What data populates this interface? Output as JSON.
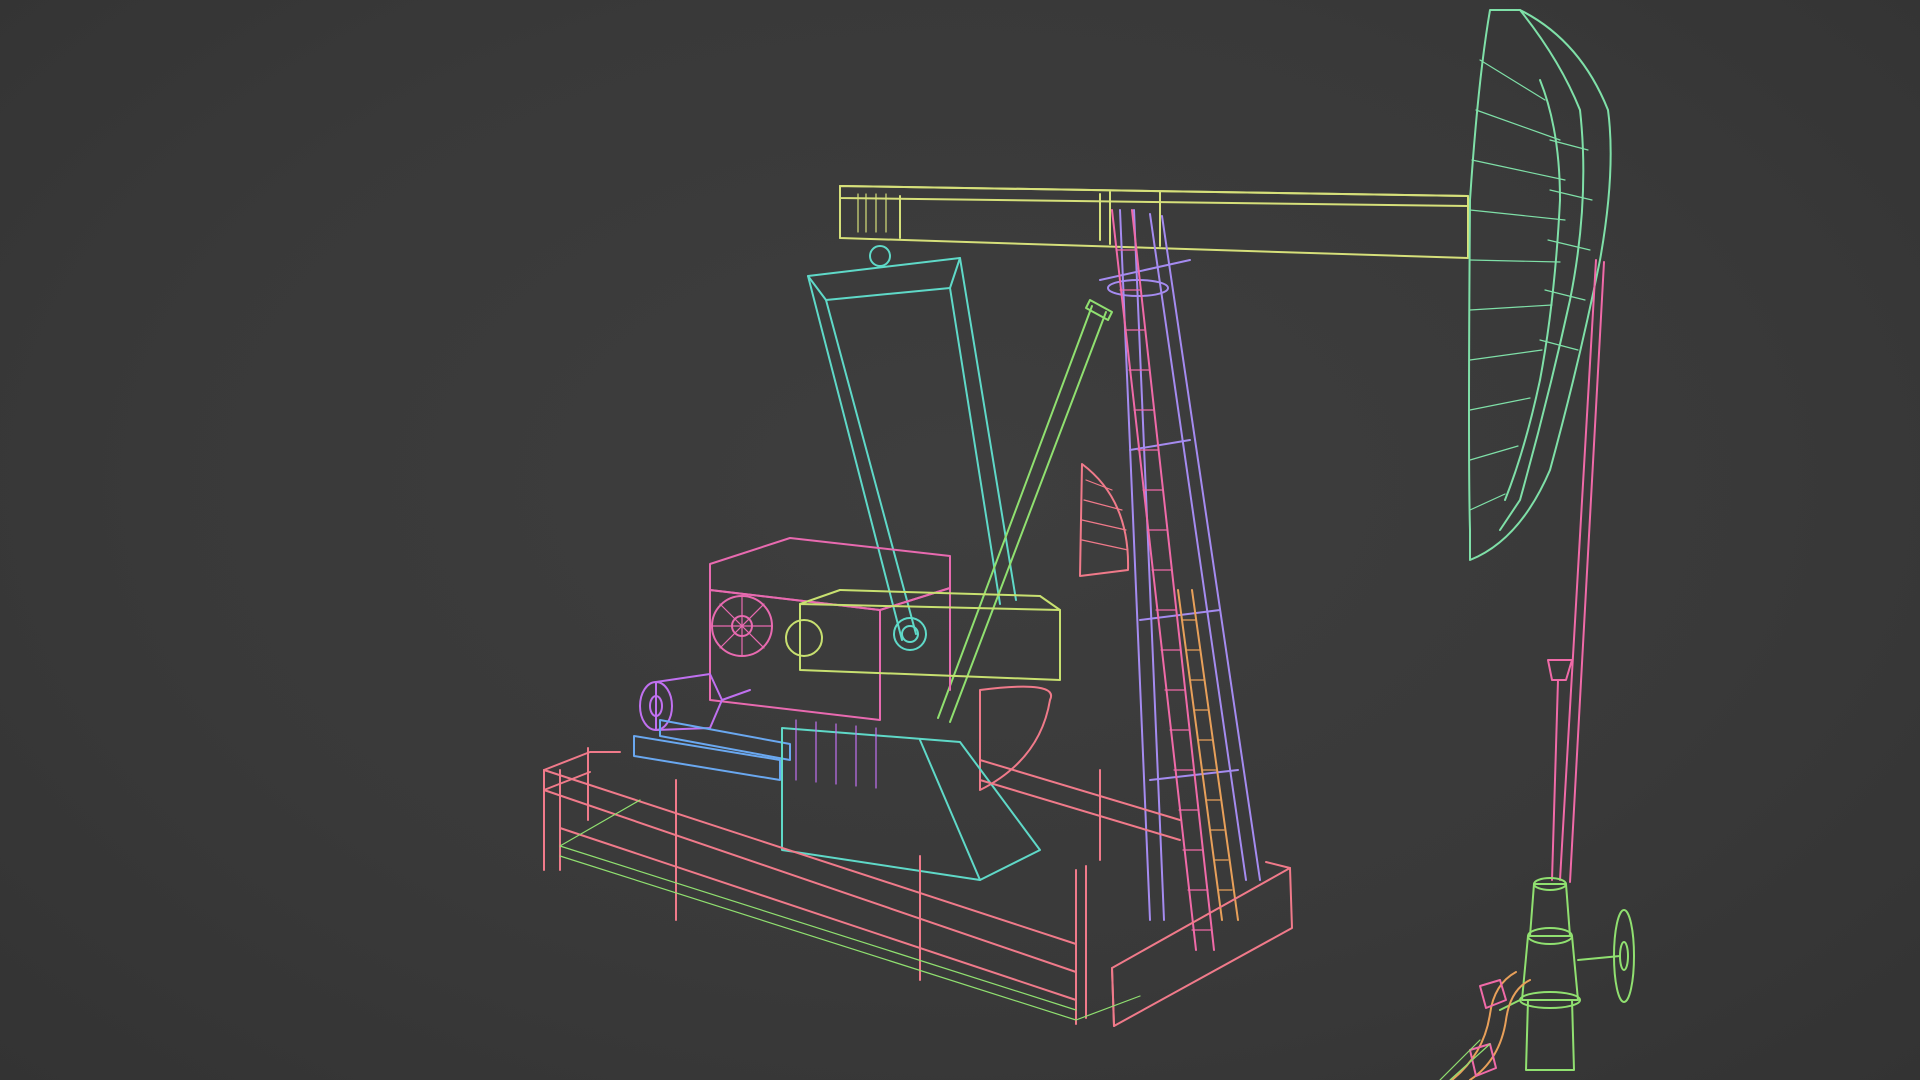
{
  "viewport": {
    "background": "#3b3b3b",
    "render_mode": "wireframe"
  },
  "model": {
    "subject": "pumpjack",
    "parts": [
      {
        "name": "walking-beam",
        "color": "#d6e07a"
      },
      {
        "name": "horse-head",
        "color": "#7fe0a8"
      },
      {
        "name": "pitman-arm",
        "color": "#5fd9c8"
      },
      {
        "name": "samson-post",
        "color": "#a58bf0"
      },
      {
        "name": "ladder-front",
        "color": "#f06aa8"
      },
      {
        "name": "ladder-rear",
        "color": "#e8a05a"
      },
      {
        "name": "railing",
        "color": "#f07a8a"
      },
      {
        "name": "gearbox",
        "color": "#e86ab0"
      },
      {
        "name": "crank",
        "color": "#c8e070"
      },
      {
        "name": "motor",
        "color": "#c070f0"
      },
      {
        "name": "skid-base",
        "color": "#f07a8a"
      },
      {
        "name": "counterweight",
        "color": "#f07a8a"
      },
      {
        "name": "polished-rod",
        "color": "#f06aa8"
      },
      {
        "name": "wellhead",
        "color": "#90e070"
      },
      {
        "name": "brace",
        "color": "#90e070"
      },
      {
        "name": "motor-rail",
        "color": "#6aa8f0"
      }
    ]
  }
}
